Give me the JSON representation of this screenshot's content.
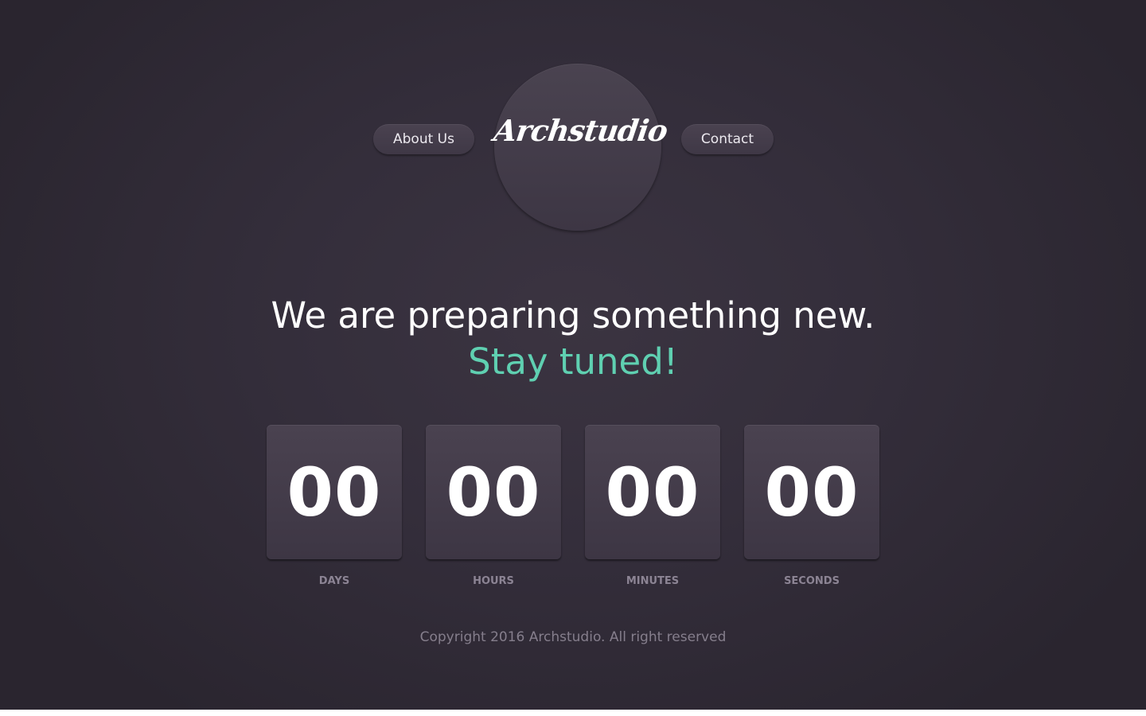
{
  "nav": {
    "about_label": "About Us",
    "contact_label": "Contact"
  },
  "logo": {
    "text": "Archstudio"
  },
  "hero": {
    "headline": "We are preparing something new.",
    "tagline": "Stay tuned!"
  },
  "countdown": [
    {
      "value": "00",
      "label": "DAYS"
    },
    {
      "value": "00",
      "label": "HOURS"
    },
    {
      "value": "00",
      "label": "MINUTES"
    },
    {
      "value": "00",
      "label": "SECONDS"
    }
  ],
  "footer": {
    "copyright": "Copyright 2016 Archstudio. All right reserved"
  },
  "colors": {
    "background": "#342e3b",
    "accent": "#5fd0b1",
    "muted_text": "#8c8494"
  }
}
